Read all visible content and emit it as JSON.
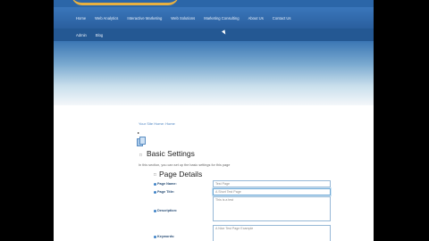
{
  "nav": {
    "primary": [
      "Home",
      "Web Analytics",
      "Interactive Marketing",
      "Web Solutions",
      "Marketing Consulting",
      "About Us",
      "Contact Us"
    ],
    "secondary": [
      "Admin",
      "Blog"
    ]
  },
  "breadcrumb": "Your Site Home: Home",
  "section": {
    "toggle": "□",
    "title": "Basic Settings",
    "hint": "In this section, you can set up the basic settings for this page"
  },
  "page_details": {
    "toggle": "□",
    "title": "Page Details",
    "fields": [
      {
        "label": "Page Name:",
        "value": "Test Page"
      },
      {
        "label": "Page Title:",
        "value": "A Short Test Page"
      },
      {
        "label": "Description:",
        "value": "This is a test"
      },
      {
        "label": "Keywords:",
        "value": "A Nice Test Page Example"
      }
    ]
  }
}
